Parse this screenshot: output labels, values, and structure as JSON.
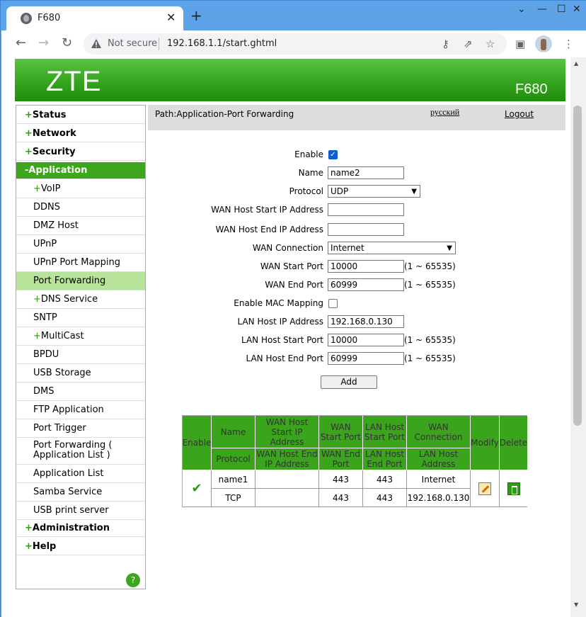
{
  "browser": {
    "tab_title": "F680",
    "security_label": "Not secure",
    "url": "192.168.1.1/start.ghtml",
    "icons": [
      "globe-icon",
      "close-icon",
      "new-tab-icon",
      "back-icon",
      "forward-icon",
      "reload-icon",
      "warning-icon",
      "key-icon",
      "share-icon",
      "star-icon",
      "sidebar-icon",
      "profile-avatar",
      "menu-icon",
      "minimize-icon",
      "maximize-icon",
      "window-close-icon"
    ]
  },
  "header": {
    "logo": "ZTE",
    "model": "F680"
  },
  "path_bar": {
    "path": "Path:Application-Port Forwarding",
    "language": "русский",
    "logout": "Logout"
  },
  "sidebar": {
    "items": [
      {
        "prefix": "+",
        "label": "Status"
      },
      {
        "prefix": "+",
        "label": "Network"
      },
      {
        "prefix": "+",
        "label": "Security"
      },
      {
        "prefix": "-",
        "label": "Application"
      }
    ],
    "sub_items": [
      {
        "prefix": "+",
        "label": "VoIP"
      },
      {
        "prefix": "",
        "label": "DDNS"
      },
      {
        "prefix": "",
        "label": "DMZ Host"
      },
      {
        "prefix": "",
        "label": "UPnP"
      },
      {
        "prefix": "",
        "label": "UPnP Port Mapping"
      },
      {
        "prefix": "",
        "label": "Port Forwarding"
      },
      {
        "prefix": "+",
        "label": "DNS Service"
      },
      {
        "prefix": "",
        "label": "SNTP"
      },
      {
        "prefix": "+",
        "label": "MultiCast"
      },
      {
        "prefix": "",
        "label": "BPDU"
      },
      {
        "prefix": "",
        "label": "USB Storage"
      },
      {
        "prefix": "",
        "label": "DMS"
      },
      {
        "prefix": "",
        "label": "FTP Application"
      },
      {
        "prefix": "",
        "label": "Port Trigger"
      },
      {
        "prefix": "",
        "label": "Port Forwarding ( Application List )"
      },
      {
        "prefix": "",
        "label": "Application List"
      },
      {
        "prefix": "",
        "label": "Samba Service"
      },
      {
        "prefix": "",
        "label": "USB print server"
      }
    ],
    "bottom_items": [
      {
        "prefix": "+",
        "label": "Administration"
      },
      {
        "prefix": "+",
        "label": "Help"
      }
    ],
    "help_icon": "?",
    "accent_color": "#3da61d",
    "selected_color": "#b7e39b"
  },
  "form": {
    "enable_label": "Enable",
    "enable_checked": true,
    "name_label": "Name",
    "name_value": "name2",
    "protocol_label": "Protocol",
    "protocol_value": "UDP",
    "wan_start_ip_label": "WAN Host Start IP Address",
    "wan_start_ip_value": "",
    "wan_end_ip_label": "WAN Host End IP Address",
    "wan_end_ip_value": "",
    "wan_connection_label": "WAN Connection",
    "wan_connection_value": "Internet",
    "wan_start_port_label": "WAN Start Port",
    "wan_start_port_value": "10000",
    "wan_start_port_range": "(1 ~ 65535)",
    "wan_end_port_label": "WAN End Port",
    "wan_end_port_value": "60999",
    "wan_end_port_range": "(1 ~ 65535)",
    "mac_mapping_label": "Enable MAC Mapping",
    "mac_mapping_checked": false,
    "lan_ip_label": "LAN Host IP Address",
    "lan_ip_value": "192.168.0.130",
    "lan_start_port_label": "LAN Host Start Port",
    "lan_start_port_value": "10000",
    "lan_start_port_range": "(1 ~ 65535)",
    "lan_end_port_label": "LAN Host End Port",
    "lan_end_port_value": "60999",
    "lan_end_port_range": "(1 ~ 65535)",
    "add_button": "Add"
  },
  "table": {
    "header_color": "#3aa41c",
    "headers": {
      "enable": "Enable",
      "name": "Name",
      "wan_start_ip": "WAN Host Start IP Address",
      "wan_start_port": "WAN Start Port",
      "lan_start_port": "LAN Host Start Port",
      "wan_connection": "WAN Connection",
      "modify": "Modify",
      "delete": "Delete",
      "protocol": "Protocol",
      "wan_end_ip": "WAN Host End IP Address",
      "wan_end_port": "WAN End Port",
      "lan_end_port": "LAN Host End Port",
      "lan_address": "LAN Host Address"
    },
    "rows": [
      {
        "enabled": true,
        "name": "name1",
        "wan_start_ip": "",
        "wan_start_port": "443",
        "lan_start_port": "443",
        "wan_connection": "Internet",
        "protocol": "TCP",
        "wan_end_ip": "",
        "wan_end_port": "443",
        "lan_end_port": "443",
        "lan_address": "192.168.0.130"
      }
    ]
  }
}
